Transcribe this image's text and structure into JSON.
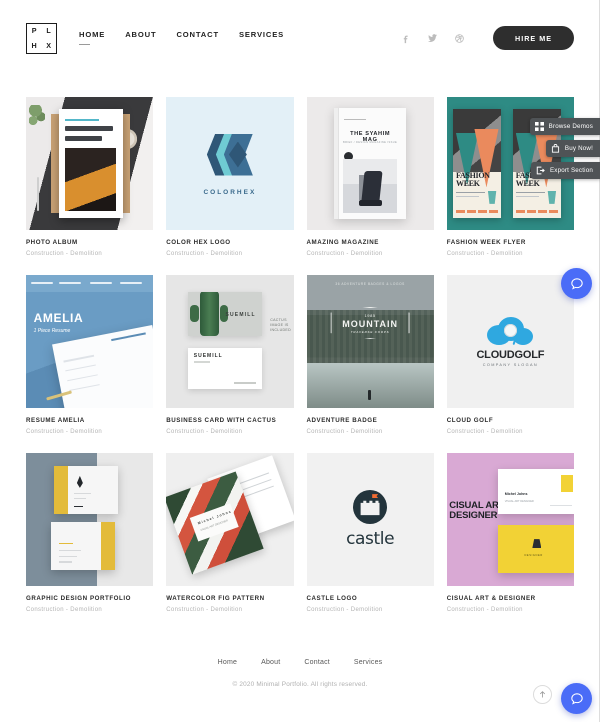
{
  "header": {
    "logo_letters": [
      "P",
      "L",
      "H",
      "X"
    ],
    "nav": [
      {
        "label": "HOME",
        "active": true
      },
      {
        "label": "ABOUT",
        "active": false
      },
      {
        "label": "CONTACT",
        "active": false
      },
      {
        "label": "SERVICES",
        "active": false
      }
    ],
    "social": [
      {
        "name": "facebook-icon",
        "title": "Facebook"
      },
      {
        "name": "twitter-icon",
        "title": "Twitter"
      },
      {
        "name": "dribbble-icon",
        "title": "Dribbble"
      }
    ],
    "cta_label": "HIRE ME"
  },
  "demo_tools": [
    {
      "label": "Browse Demos",
      "icon": "grid-icon"
    },
    {
      "label": "Buy Now!",
      "icon": "bag-icon"
    },
    {
      "label": "Export Section",
      "icon": "export-icon"
    }
  ],
  "portfolio": {
    "items": [
      {
        "title": "PHOTO ALBUM",
        "subtitle": "Construction  -  Demolition",
        "art": "a1"
      },
      {
        "title": "COLOR HEX LOGO",
        "subtitle": "Construction  -  Demolition",
        "art": "a2"
      },
      {
        "title": "AMAZING MAGAZINE",
        "subtitle": "Construction  -  Demolition",
        "art": "a3"
      },
      {
        "title": "FASHION WEEK FLYER",
        "subtitle": "Construction  -  Demolition",
        "art": "a4"
      },
      {
        "title": "RESUME AMELIA",
        "subtitle": "Construction  -  Demolition",
        "art": "a5"
      },
      {
        "title": "BUSINESS CARD WITH CACTUS",
        "subtitle": "Construction  -  Demolition",
        "art": "a6"
      },
      {
        "title": "ADVENTURE BADGE",
        "subtitle": "Construction  -  Demolition",
        "art": "a7"
      },
      {
        "title": "CLOUD GOLF",
        "subtitle": "Construction  -  Demolition",
        "art": "a8"
      },
      {
        "title": "GRAPHIC DESIGN PORTFOLIO",
        "subtitle": "Construction  -  Demolition",
        "art": "a9"
      },
      {
        "title": "WATERCOLOR FIG PATTERN",
        "subtitle": "Construction  -  Demolition",
        "art": "a10"
      },
      {
        "title": "CASTLE LOGO",
        "subtitle": "Construction  -  Demolition",
        "art": "a11"
      },
      {
        "title": "CISUAL ART & DESIGNER",
        "subtitle": "Construction  -  Demolition",
        "art": "a12"
      }
    ]
  },
  "artwork": {
    "colorhex": {
      "wordmark": "COLORHEX"
    },
    "magazine": {
      "title": "THE SYAHIM MAG",
      "subtitle": "BRIEF / DESIGN MAGAZINE ISSUE"
    },
    "fashion": {
      "line1": "FASHION",
      "line2": "WEEK"
    },
    "resume": {
      "name": "AMELIA",
      "tagline": "1 Piece Resume"
    },
    "cactus": {
      "brand_top": "SUEMILL",
      "brand_bottom": "SUEMILL",
      "note": "CACTUS\nIMAGE IS\nINCLUDED"
    },
    "mountain": {
      "kicker": "36 ADVENTURE BADGES & LOGOS",
      "est": "1985",
      "name": "MOUNTAIN",
      "sub": "TRAVERSE CORPS",
      "left": "Quality",
      "right": "Nature"
    },
    "cloudgolf": {
      "name": "CLOUDGOLF",
      "slogan": "COMPANY SLOGAN"
    },
    "castle": {
      "name": "castle"
    },
    "cisual": {
      "line1": "CISUAL ART &",
      "line2": "DESIGNER",
      "card_name": "Michel Johns",
      "card_role": "VISUAL ART DESIGNER",
      "badge": "DESIGNER"
    }
  },
  "footer": {
    "nav": [
      {
        "label": "Home"
      },
      {
        "label": "About"
      },
      {
        "label": "Contact"
      },
      {
        "label": "Services"
      }
    ],
    "copyright": "© 2020 Minimal Portfolio. All rights reserved.",
    "to_top_icon": "arrow-up-icon"
  },
  "chat": {
    "icon": "chat-bubble-icon"
  },
  "colors": {
    "accent_blue": "#4a6cf7",
    "dark": "#2e2e2e",
    "muted": "#b4b4b4",
    "tool_bg": "#4f5356"
  }
}
